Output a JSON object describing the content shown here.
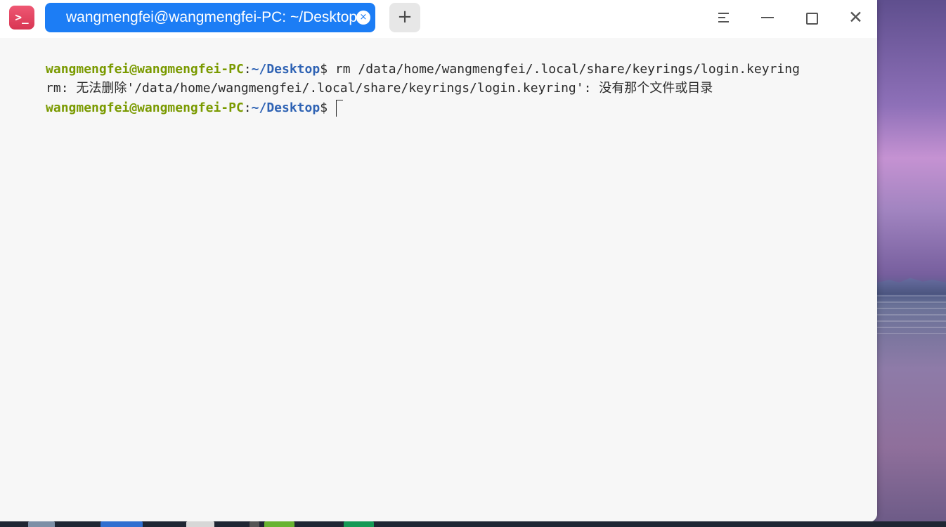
{
  "colors": {
    "tab_active": "#1c7df5",
    "terminal_background": "#f7f7f7",
    "prompt_user_host": "#7a9a00",
    "prompt_path": "#2f63b4",
    "app_icon": "#d83553"
  },
  "window": {
    "app_icon": "terminal-icon",
    "app_icon_glyph": ">_",
    "tabs": [
      {
        "title": "wangmengfei@wangmengfei-PC: ~/Desktop",
        "close_glyph": "×"
      }
    ],
    "new_tab_glyph": "+",
    "controls": [
      {
        "name": "menu",
        "icon": "menu-icon"
      },
      {
        "name": "minimize",
        "icon": "minimize-icon"
      },
      {
        "name": "maximize",
        "icon": "maximize-icon"
      },
      {
        "name": "close",
        "icon": "close-icon",
        "glyph": "✕"
      }
    ]
  },
  "terminal": {
    "lines": [
      {
        "user_host": "wangmengfei@wangmengfei-PC",
        "separator": ":",
        "path": "~/Desktop",
        "prompt_symbol": "$",
        "command": " rm /data/home/wangmengfei/.local/share/keyrings/login.keyring"
      },
      {
        "text": "rm: 无法删除'/data/home/wangmengfei/.local/share/keyrings/login.keyring': 没有那个文件或目录"
      },
      {
        "user_host": "wangmengfei@wangmengfei-PC",
        "separator": ":",
        "path": "~/Desktop",
        "prompt_symbol": "$",
        "command": " "
      }
    ]
  }
}
